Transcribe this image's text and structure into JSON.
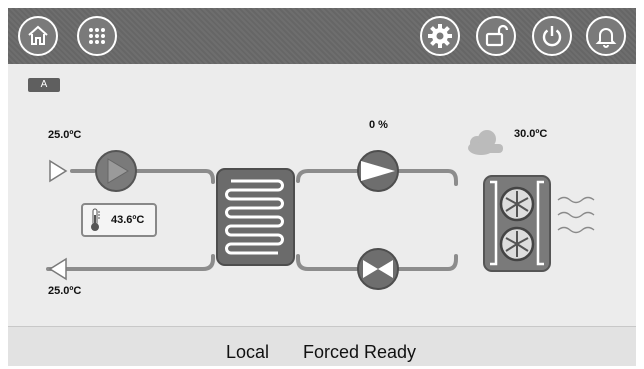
{
  "toolbar": {
    "left_buttons": [
      {
        "name": "home-icon",
        "label": "Home"
      },
      {
        "name": "menu-grid-icon",
        "label": "Menu"
      }
    ],
    "right_buttons": [
      {
        "name": "gear-icon",
        "label": "Settings"
      },
      {
        "name": "unlock-icon",
        "label": "Unlock"
      },
      {
        "name": "power-icon",
        "label": "Power"
      },
      {
        "name": "bell-icon",
        "label": "Alarms"
      }
    ]
  },
  "unit_badge": "A",
  "inlet": {
    "temp": "25.0ºC"
  },
  "outlet": {
    "temp": "25.0ºC"
  },
  "water_temp": "43.6ºC",
  "compressor": {
    "percent": "0 %"
  },
  "outdoor": {
    "temp": "30.0ºC"
  },
  "status": {
    "mode": "Local",
    "state": "Forced Ready"
  },
  "colors": {
    "toolbar": "#6a6a6a",
    "pipe": "#8c8c8c",
    "component": "#6b6b6b",
    "background": "#ececec"
  }
}
